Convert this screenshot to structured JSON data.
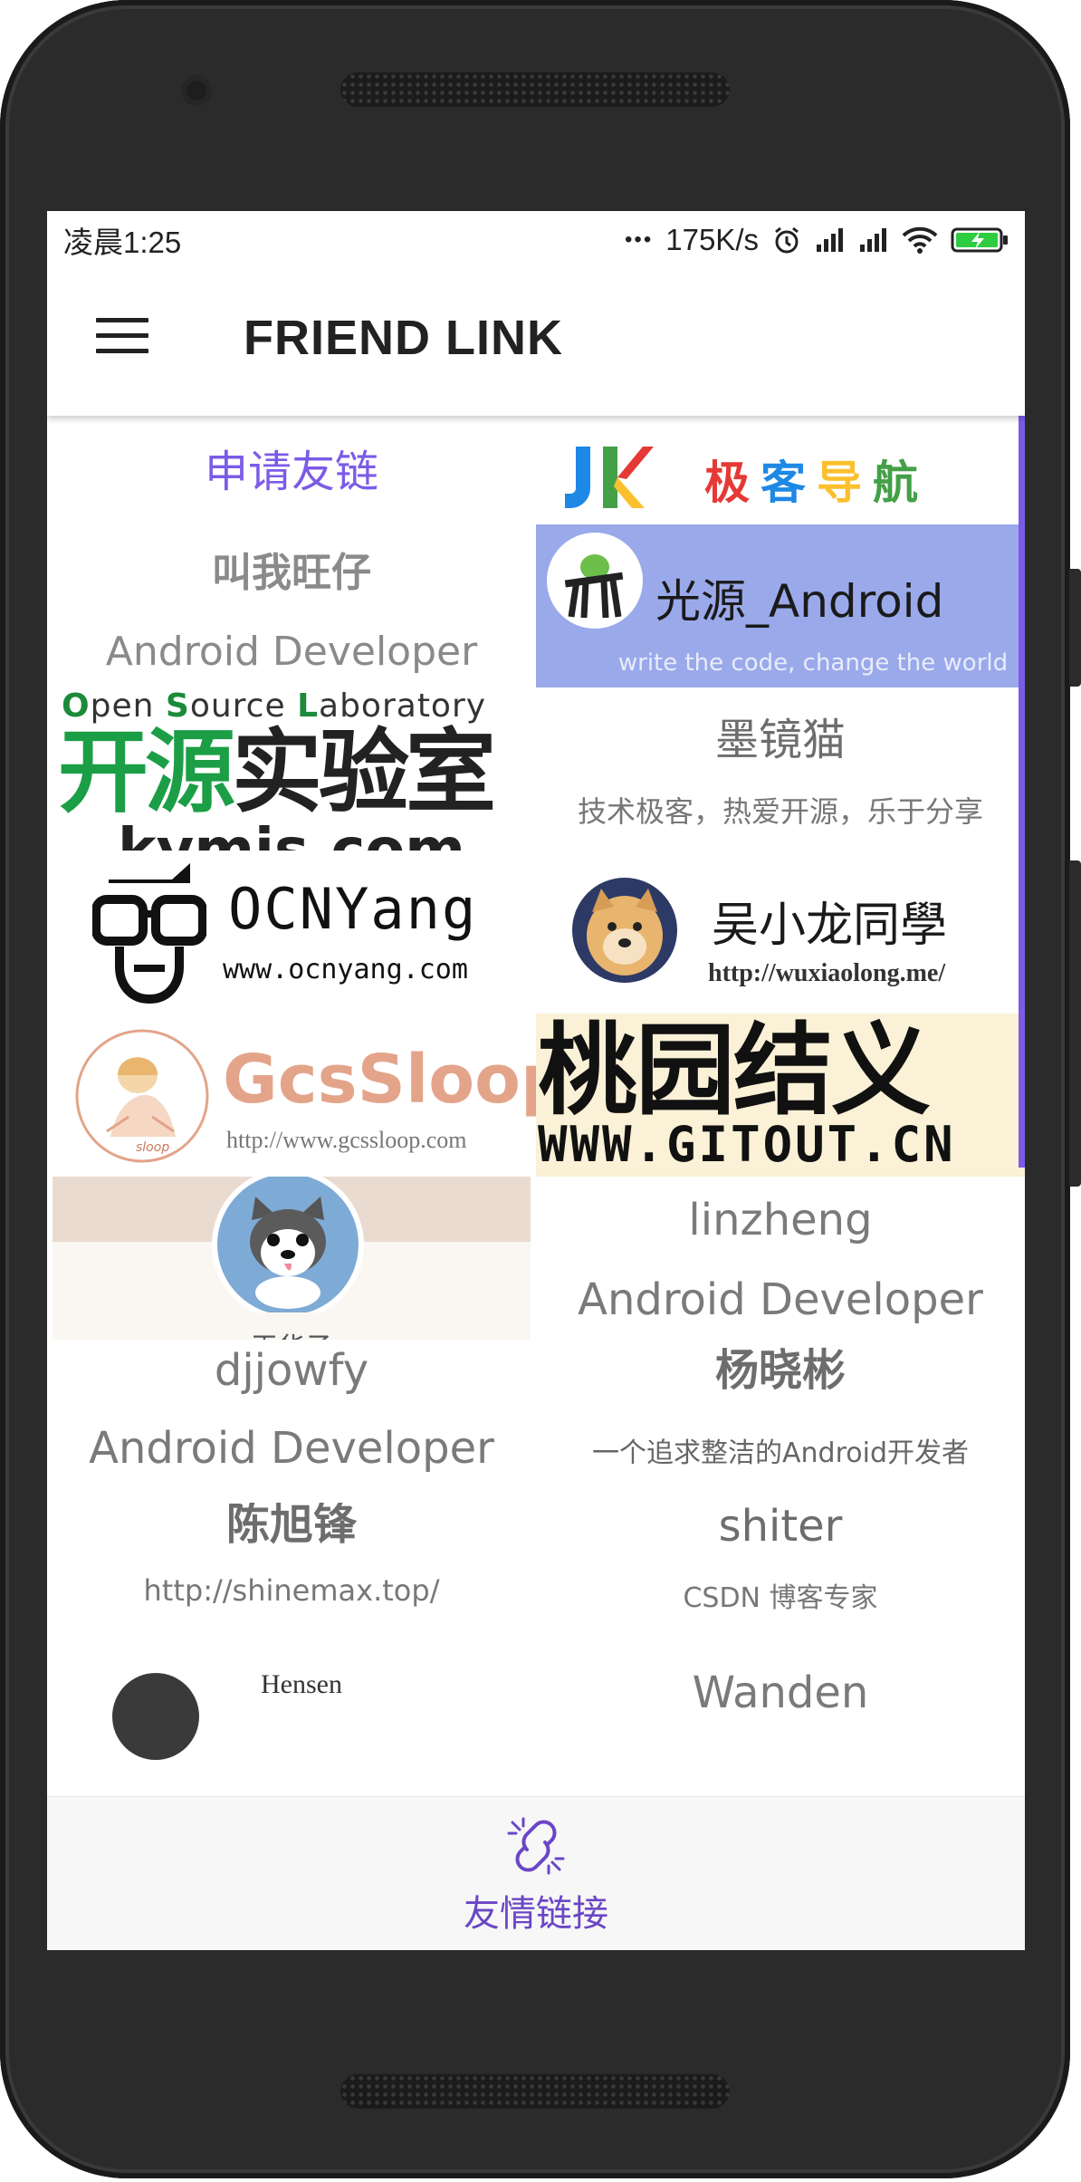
{
  "status_bar": {
    "time": "凌晨1:25",
    "more": "•••",
    "net_speed": "175K/s"
  },
  "app_bar": {
    "title": "FRIEND LINK"
  },
  "links": {
    "apply": "申请友链",
    "jike": {
      "logo_letters": "JK",
      "name": [
        "极",
        "客",
        "导",
        "航"
      ],
      "letter_colors": [
        "#e53935",
        "#1e88e5",
        "#fbc02d",
        "#43a047"
      ]
    },
    "wangzai": {
      "name": "叫我旺仔",
      "subtitle": "Android Developer"
    },
    "guangyuan": {
      "name": "光源_Android",
      "subtitle": "write the code, change the world",
      "bg_color": "#9aa9ea"
    },
    "oslab": {
      "tagline_parts": [
        {
          "letter": "O",
          "rest": "pen "
        },
        {
          "letter": "S",
          "rest": "ource "
        },
        {
          "letter": "L",
          "rest": "aboratory"
        }
      ],
      "name": "开源实验室",
      "domain": "kymjs.com"
    },
    "mojingmao": {
      "name": "墨镜猫",
      "subtitle": "技术极客，热爱开源，乐于分享"
    },
    "ocnyang": {
      "name": "OCNYang",
      "url": "www.ocnyang.com"
    },
    "wuxiaolong": {
      "name": "吴小龙同學",
      "url": "http://wuxiaolong.me/"
    },
    "gcssloop": {
      "name": "GcsSloop",
      "url": "http://www.gcssloop.com",
      "avatar_caption": "sloop"
    },
    "gitout": {
      "name": "桃园结义",
      "url": "WWW.GITOUT.CN"
    },
    "husky": {
      "caption": "王华子"
    },
    "linzheng": {
      "name": "linzheng",
      "subtitle": "Android Developer"
    },
    "djjowfy": {
      "name": "djjowfy",
      "subtitle": "Android Developer"
    },
    "yangxiaobin": {
      "name": "杨晓彬",
      "subtitle": "一个追求整洁的Android开发者"
    },
    "chenxufeng": {
      "name": "陈旭锋",
      "subtitle": "http://shinemax.top/"
    },
    "shiter": {
      "name": "shiter",
      "subtitle": "CSDN 博客专家"
    },
    "hensen": {
      "name": "Hensen"
    },
    "wanden": {
      "name": "Wanden"
    }
  },
  "bottom_nav": {
    "label": "友情链接",
    "icon": "link-icon"
  },
  "colors": {
    "accent": "#7b5be6",
    "nav_active": "#6a46c6"
  }
}
